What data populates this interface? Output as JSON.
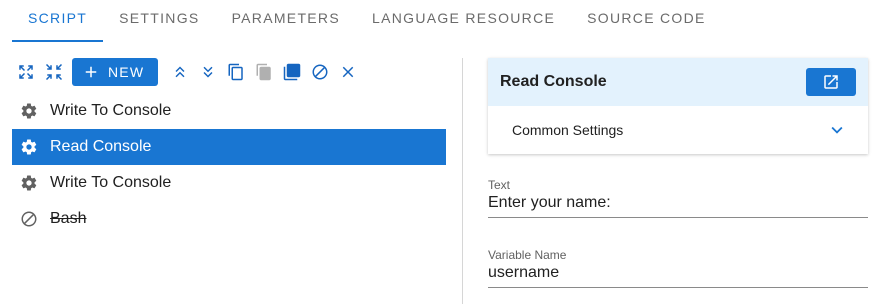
{
  "tabs": [
    {
      "label": "SCRIPT",
      "active": true
    },
    {
      "label": "SETTINGS",
      "active": false
    },
    {
      "label": "PARAMETERS",
      "active": false
    },
    {
      "label": "LANGUAGE RESOURCE",
      "active": false
    },
    {
      "label": "SOURCE CODE",
      "active": false
    }
  ],
  "toolbar": {
    "new_label": "NEW",
    "icons": [
      "expand-all-icon",
      "collapse-all-icon",
      "plus-icon",
      "move-up-icon",
      "move-down-icon",
      "copy-icon",
      "paste-icon",
      "duplicate-icon",
      "disable-icon",
      "delete-icon"
    ]
  },
  "tree": {
    "items": [
      {
        "label": "Write To Console",
        "icon": "gear-icon",
        "selected": false,
        "disabled": false
      },
      {
        "label": "Read Console",
        "icon": "gear-icon",
        "selected": true,
        "disabled": false
      },
      {
        "label": "Write To Console",
        "icon": "gear-icon",
        "selected": false,
        "disabled": false
      },
      {
        "label": "Bash",
        "icon": "disabled-icon",
        "selected": false,
        "disabled": true
      }
    ]
  },
  "panel": {
    "title": "Read Console",
    "common_settings_label": "Common Settings",
    "fields": {
      "text": {
        "label": "Text",
        "value": "Enter your name:"
      },
      "variable_name": {
        "label": "Variable Name",
        "value": "username"
      }
    }
  },
  "colors": {
    "accent": "#1976d2",
    "header_bg": "#e3f2fd"
  }
}
